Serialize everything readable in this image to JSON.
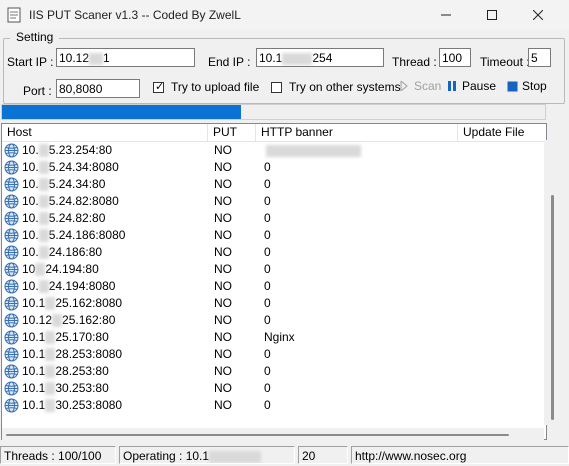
{
  "window": {
    "title": "IIS PUT Scaner v1.3 -- Coded By ZwelL",
    "controls": [
      "minimize-icon",
      "maximize-icon",
      "close-icon"
    ]
  },
  "setting": {
    "group_title": "Setting",
    "start_ip_label": "Start IP :",
    "start_ip_prefix": "10.12",
    "start_ip_suffix": "1",
    "end_ip_label": "End IP :",
    "end_ip_prefix": "10.1",
    "end_ip_suffix": "254",
    "thread_label": "Thread :",
    "thread_value": "100",
    "timeout_label": "Timeout :",
    "timeout_value": "5",
    "port_label": "Port :",
    "port_value": "80,8080",
    "upload_label": "Try to upload file",
    "upload_checked": true,
    "other_systems_label": "Try on other systems",
    "other_systems_checked": false,
    "scan_label": "Scan",
    "pause_label": "Pause",
    "stop_label": "Stop"
  },
  "progress": {
    "fraction": 0.44
  },
  "table": {
    "columns": [
      "Host",
      "PUT",
      "HTTP banner",
      "Update File"
    ],
    "rows": [
      {
        "host_a": "10.",
        "host_b": "5.23.254:80",
        "put": "NO",
        "banner": "",
        "update": ""
      },
      {
        "host_a": "10.",
        "host_b": "5.24.34:8080",
        "put": "NO",
        "banner": "0",
        "update": ""
      },
      {
        "host_a": "10.",
        "host_b": "5.24.34:80",
        "put": "NO",
        "banner": "0",
        "update": ""
      },
      {
        "host_a": "10.",
        "host_b": "5.24.82:8080",
        "put": "NO",
        "banner": "0",
        "update": ""
      },
      {
        "host_a": "10.",
        "host_b": "5.24.82:80",
        "put": "NO",
        "banner": "0",
        "update": ""
      },
      {
        "host_a": "10.",
        "host_b": "5.24.186:8080",
        "put": "NO",
        "banner": "0",
        "update": ""
      },
      {
        "host_a": "10.",
        "host_b": "24.186:80",
        "put": "NO",
        "banner": "0",
        "update": ""
      },
      {
        "host_a": "10",
        "host_b": "24.194:80",
        "put": "NO",
        "banner": "0",
        "update": ""
      },
      {
        "host_a": "10.",
        "host_b": "24.194:8080",
        "put": "NO",
        "banner": "0",
        "update": ""
      },
      {
        "host_a": "10.1",
        "host_b": "25.162:8080",
        "put": "NO",
        "banner": "0",
        "update": ""
      },
      {
        "host_a": "10.12",
        "host_b": "25.162:80",
        "put": "NO",
        "banner": "0",
        "update": ""
      },
      {
        "host_a": "10.1",
        "host_b": "25.170:80",
        "put": "NO",
        "banner": "Nginx",
        "update": ""
      },
      {
        "host_a": "10.1",
        "host_b": "28.253:8080",
        "put": "NO",
        "banner": "0",
        "update": ""
      },
      {
        "host_a": "10.1",
        "host_b": "28.253:80",
        "put": "NO",
        "banner": "0",
        "update": ""
      },
      {
        "host_a": "10.1",
        "host_b": "30.253:80",
        "put": "NO",
        "banner": "0",
        "update": ""
      },
      {
        "host_a": "10.1",
        "host_b": "30.253:8080",
        "put": "NO",
        "banner": "0",
        "update": ""
      }
    ]
  },
  "status": {
    "threads": "Threads : 100/100",
    "operating": "Operating : 10.1",
    "count": "20",
    "url": "http://www.nosec.org"
  },
  "colors": {
    "progress": "#0a73d4",
    "stop_icon": "#1565c0",
    "pause_icon": "#1565c0",
    "scan_icon_disabled": "#a0a0a0"
  }
}
